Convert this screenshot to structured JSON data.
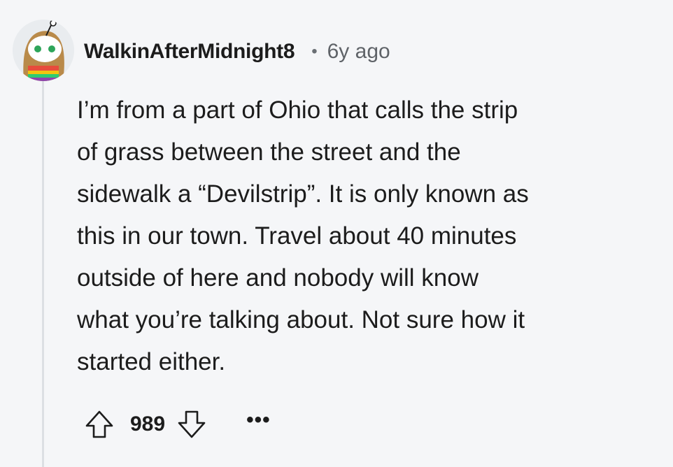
{
  "comment": {
    "author": "WalkinAfterMidnight8",
    "separator": "•",
    "age": "6y ago",
    "body": "I’m from a part of Ohio that calls the strip\nof grass between the street and the\nsidewalk a “Devilstrip”. It is only known as\nthis in our town. Travel about 40 minutes\noutside of here and nobody will know\nwhat you’re talking about. Not sure how it\nstarted either.",
    "score": "989",
    "more_label": "•••"
  },
  "icons": {
    "avatar": "snoo-avatar",
    "upvote": "arrow-up-outline-icon",
    "downvote": "arrow-down-outline-icon",
    "more": "ellipsis-icon"
  },
  "colors": {
    "background": "#f5f6f8",
    "text": "#1c1c1c",
    "muted": "#5f6368",
    "thread_line": "#dcdfe3"
  }
}
